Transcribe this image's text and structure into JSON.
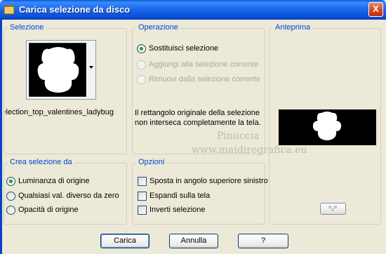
{
  "window": {
    "title": "Carica selezione da disco",
    "close_label": "X"
  },
  "selezione": {
    "title": "Selezione",
    "filename": "selection_top_valentines_ladybug"
  },
  "operazione": {
    "title": "Operazione",
    "options": [
      {
        "label": "Sostituisci selezione",
        "checked": true,
        "enabled": true
      },
      {
        "label": "Aggiungi alla selezione corrente",
        "checked": false,
        "enabled": false
      },
      {
        "label": "Rimuovi dalla selezione corrente",
        "checked": false,
        "enabled": false
      }
    ],
    "note": "Il rettangolo originale della selezione non interseca completamente la tela."
  },
  "anteprima": {
    "title": "Anteprima"
  },
  "crea_selezione": {
    "title": "Crea selezione da",
    "options": [
      {
        "label": "Luminanza di origine",
        "checked": true
      },
      {
        "label": "Qualsiasi val. diverso da zero",
        "checked": false
      },
      {
        "label": "Opacità di origine",
        "checked": false
      }
    ]
  },
  "opzioni": {
    "title": "Opzioni",
    "options": [
      {
        "label": "Sposta in angolo superiore sinistro",
        "checked": false
      },
      {
        "label": "Espandi sulla tela",
        "checked": false
      },
      {
        "label": "Inverti selezione",
        "checked": false
      }
    ]
  },
  "watermark": {
    "line1": "Pinuccia",
    "line2": "www.maidiregrafica.eu"
  },
  "buttons": {
    "load": "Carica",
    "cancel": "Annulla",
    "help": "?"
  }
}
